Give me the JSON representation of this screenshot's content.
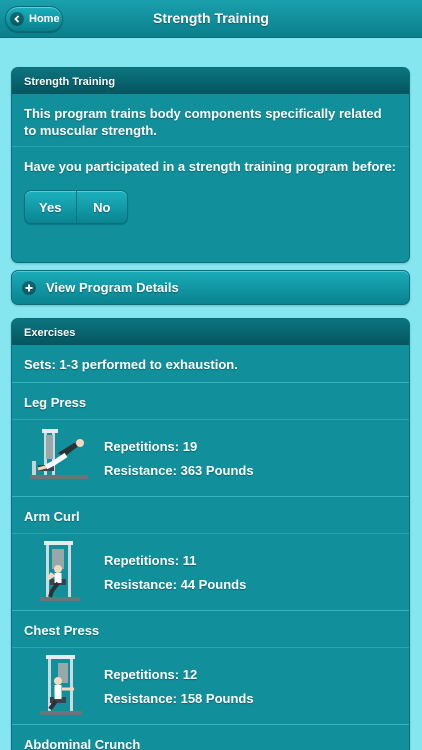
{
  "header": {
    "home_label": "Home",
    "title": "Strength Training"
  },
  "intro_panel": {
    "heading": "Strength Training",
    "description": "This program trains body components specifically related to muscular strength.",
    "question": "Have you participated in a strength training program before:",
    "options": [
      "Yes",
      "No"
    ]
  },
  "details_toggle": {
    "label": "View Program Details"
  },
  "exercises_panel": {
    "heading": "Exercises",
    "sets": "Sets: 1-3 performed to exhaustion.",
    "items": [
      {
        "name": "Leg Press",
        "reps": "Repetitions: 19",
        "resistance": "Resistance: 363 Pounds",
        "icon": "leg-press-machine-icon"
      },
      {
        "name": "Arm Curl",
        "reps": "Repetitions: 11",
        "resistance": "Resistance: 44 Pounds",
        "icon": "arm-curl-machine-icon"
      },
      {
        "name": "Chest Press",
        "reps": "Repetitions: 12",
        "resistance": "Resistance: 158 Pounds",
        "icon": "chest-press-machine-icon"
      },
      {
        "name": "Abdominal Crunch"
      }
    ]
  },
  "colors": {
    "background": "#86e6ef",
    "panel": "#11909c",
    "panel_header": "#05555e"
  }
}
